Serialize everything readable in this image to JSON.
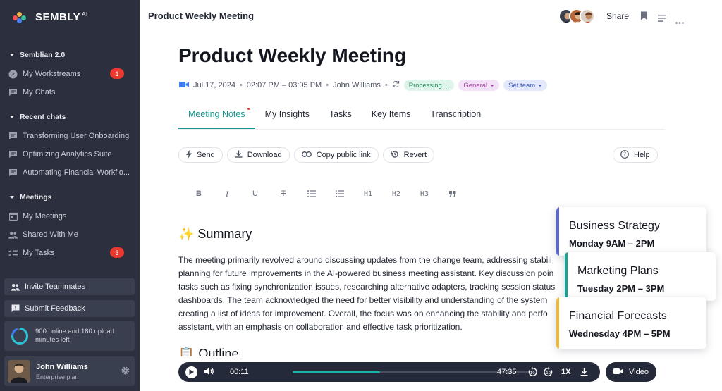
{
  "brand": {
    "name": "SEMBLY",
    "suffix": "AI",
    "colors": [
      "#f0564d",
      "#f2b64a",
      "#3dbf9e",
      "#4a7ef2"
    ]
  },
  "sidebar": {
    "sections": [
      {
        "title": "Semblian 2.0"
      },
      {
        "title": "Recent chats"
      },
      {
        "title": "Meetings"
      }
    ],
    "items": [
      {
        "label": "My Workstreams",
        "icon": "compass-icon",
        "badge": "1"
      },
      {
        "label": "My Chats",
        "icon": "chat-icon"
      },
      {
        "label": "Transforming User Onboarding",
        "icon": "chat-icon"
      },
      {
        "label": "Optimizing Analytics Suite",
        "icon": "chat-icon"
      },
      {
        "label": "Automating Financial Workflo...",
        "icon": "chat-icon"
      },
      {
        "label": "My Meetings",
        "icon": "calendar-icon"
      },
      {
        "label": "Shared With Me",
        "icon": "people-icon"
      },
      {
        "label": "My Tasks",
        "icon": "tasks-icon",
        "badge": "3"
      }
    ],
    "invite_label": "Invite Teammates",
    "feedback_label": "Submit Feedback",
    "usage_text": "900 online and 180 upload minutes left",
    "user": {
      "name": "John Williams",
      "plan": "Enterprise plan"
    }
  },
  "header": {
    "title": "Product Weekly Meeting",
    "share_label": "Share"
  },
  "meeting": {
    "title": "Product Weekly Meeting",
    "date": "Jul 17, 2024",
    "time": "02:07 PM – 03:05 PM",
    "host": "John Williams",
    "status": "Processing ...",
    "tag": "General",
    "team": "Set team"
  },
  "tabs": [
    {
      "label": "Meeting Notes",
      "active": true
    },
    {
      "label": "My Insights"
    },
    {
      "label": "Tasks"
    },
    {
      "label": "Key Items"
    },
    {
      "label": "Transcription"
    }
  ],
  "actions": {
    "send": "Send",
    "download": "Download",
    "copy_link": "Copy public link",
    "revert": "Revert",
    "help": "Help"
  },
  "format": {
    "h1": "H1",
    "h2": "H2",
    "h3": "H3"
  },
  "summary": {
    "emoji": "✨",
    "heading": "Summary",
    "body": "The meeting primarily revolved around discussing updates from the change team, addressing stabili\nplanning for future improvements in the AI-powered business meeting assistant. Key discussion poin\ntasks such as fixing synchronization issues, researching alternative adapters, tracking session status\ndashboards. The team acknowledged the need for better visibility and understanding of the system\ncreating a list of ideas for improvement. Overall, the focus was on enhancing the stability and perfo\nassistant, with an emphasis on collaboration and effective task prioritization."
  },
  "outline": {
    "emoji": "📋",
    "heading": "Outline"
  },
  "player": {
    "current": "00:11",
    "duration": "47:35",
    "speed": "1X",
    "progress": 0.37,
    "video_label": "Video"
  },
  "cards": [
    {
      "title": "Business Strategy",
      "time": "Monday 9AM – 2PM",
      "color": "#5b64d8"
    },
    {
      "title": "Marketing Plans",
      "time": "Tuesday 2PM – 3PM",
      "color": "#17a39a"
    },
    {
      "title": "Financial Forecasts",
      "time": "Wednesday 4PM – 5PM",
      "color": "#f2b92e"
    }
  ]
}
